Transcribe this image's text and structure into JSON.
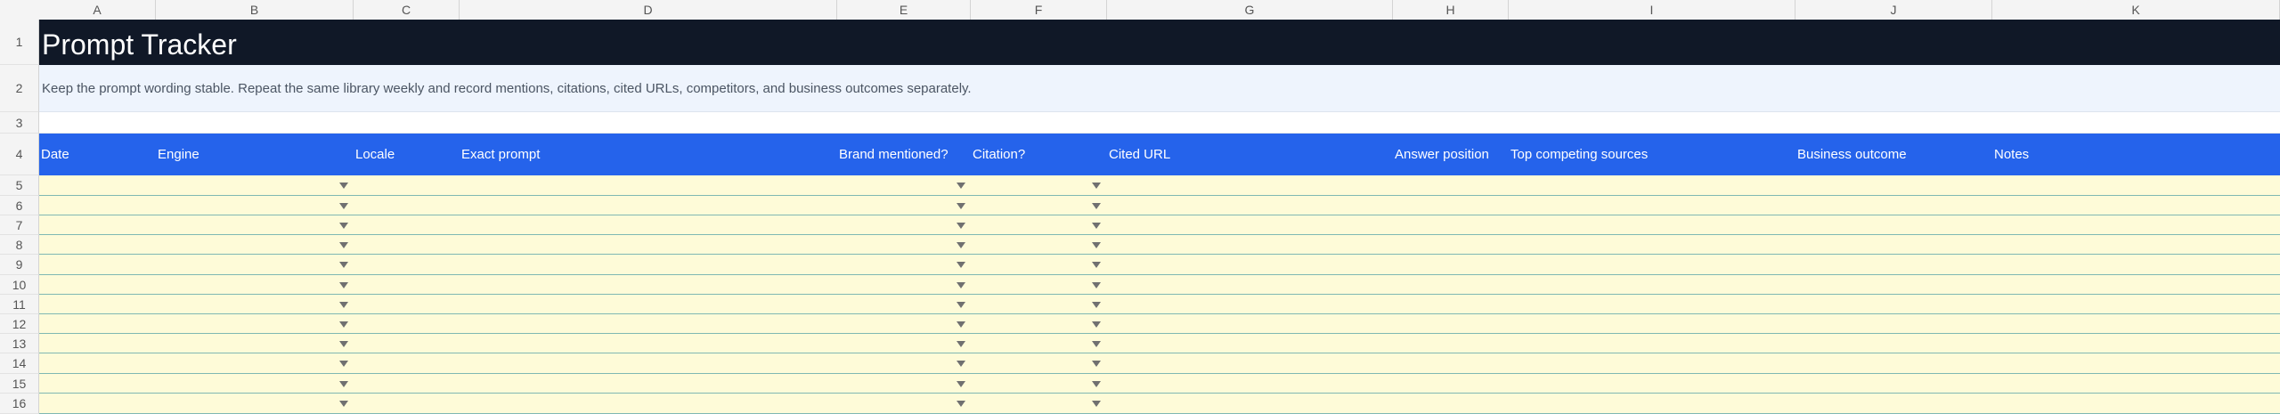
{
  "columns": [
    "A",
    "B",
    "C",
    "D",
    "E",
    "F",
    "G",
    "H",
    "I",
    "J",
    "K"
  ],
  "title": "Prompt Tracker",
  "description": "Keep the prompt wording stable. Repeat the same library weekly and record mentions, citations, cited URLs, competitors, and business outcomes separately.",
  "headers": [
    "Date",
    "Engine",
    "Locale",
    "Exact prompt",
    "Brand mentioned?",
    "Citation?",
    "Cited URL",
    "Answer position",
    "Top competing sources",
    "Business outcome",
    "Notes"
  ],
  "row_numbers": [
    "1",
    "2",
    "3",
    "4",
    "5",
    "6",
    "7",
    "8",
    "9",
    "10",
    "11",
    "12",
    "13",
    "14",
    "15",
    "16"
  ],
  "data_rows": 12,
  "dropdown_icon": "dropdown-arrow-icon",
  "colors": {
    "title_bg": "#101827",
    "header_bg": "#2563eb",
    "description_bg": "#eef4fd",
    "input_row_bg": "#fefbd8",
    "row_border": "#7fb8b3"
  }
}
